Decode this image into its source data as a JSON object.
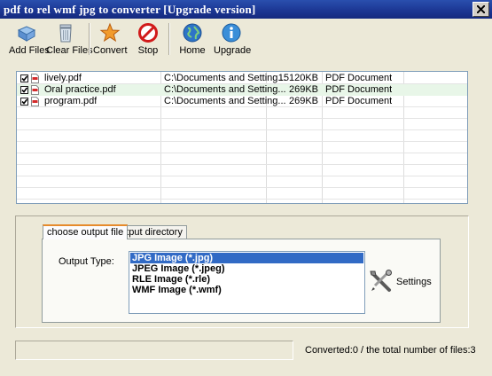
{
  "window": {
    "title": "pdf to rel wmf jpg to converter [Upgrade version]"
  },
  "toolbar": {
    "add_files": "Add Files",
    "clear_files": "Clear Files",
    "convert": "Convert",
    "stop": "Stop",
    "home": "Home",
    "upgrade": "Upgrade"
  },
  "files": [
    {
      "checked": true,
      "name": "lively.pdf",
      "path": "C:\\Documents and Setting...",
      "size": "15120KB",
      "type": "PDF Document"
    },
    {
      "checked": true,
      "name": "Oral practice.pdf",
      "path": "C:\\Documents and Setting...",
      "size": "269KB",
      "type": "PDF Document"
    },
    {
      "checked": true,
      "name": "program.pdf",
      "path": "C:\\Documents and Setting...",
      "size": "269KB",
      "type": "PDF Document"
    }
  ],
  "tabs": [
    {
      "label": "choose output file",
      "active": true
    },
    {
      "label": "output directory",
      "active": false
    }
  ],
  "output": {
    "label": "Output Type:",
    "options": [
      "JPG Image (*.jpg)",
      "JPEG Image (*.jpeg)",
      "RLE Image (*.rle)",
      "WMF Image (*.wmf)"
    ],
    "selected": "JPG Image (*.jpg)"
  },
  "settings_label": "Settings",
  "status": {
    "converted_label": "Converted:",
    "converted": "0",
    "separator": " /  the total number of files:",
    "total": "3"
  },
  "colors": {
    "titlebar": "#1b3592",
    "selection": "#316ac5",
    "active_tab_accent": "#e68b2c"
  }
}
